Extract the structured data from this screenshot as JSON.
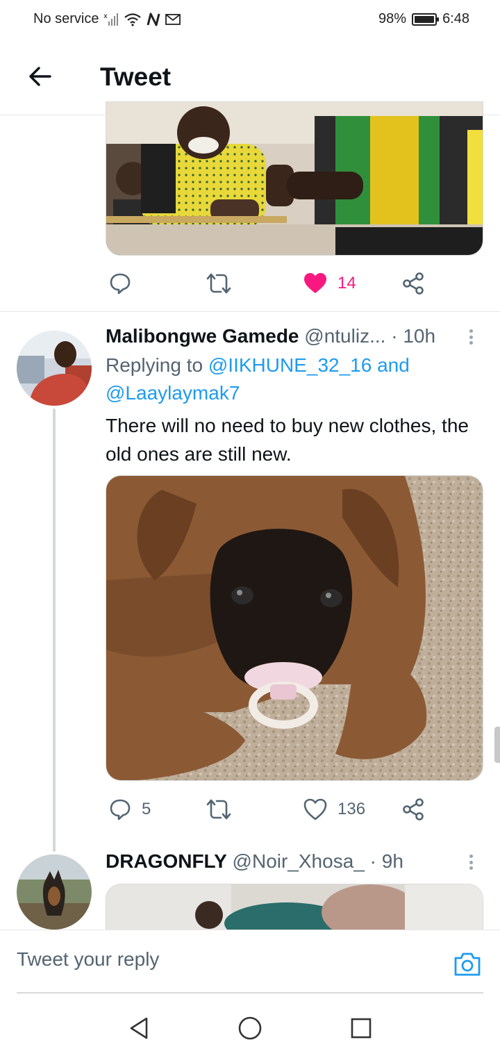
{
  "status_bar": {
    "carrier": "No service",
    "battery": "98%",
    "battery_level": 0.98,
    "time": "6:48",
    "icons": [
      "no-signal-icon",
      "wifi-icon",
      "nfc-icon",
      "gmail-icon",
      "battery-icon"
    ]
  },
  "header": {
    "title": "Tweet",
    "back_icon": "arrow-left-icon"
  },
  "tweet_above": {
    "image_alt": "photo",
    "actions": {
      "reply_count": "",
      "retweet_count": "",
      "like_count": "14",
      "liked": true
    }
  },
  "reply_tweet": {
    "name": "Malibongwe Gamede",
    "handle": "@ntuliz...",
    "separator": "·",
    "time": "10h",
    "replying_prefix": "Replying to",
    "mention_1": "@IIKHUNE_32_16",
    "conjunction": "and",
    "mention_2": "@Laaylaymak7",
    "text": "There will no need to buy new clothes, the old ones are still new.",
    "actions": {
      "reply_count": "5",
      "retweet_count": "",
      "like_count": "136",
      "liked": false
    }
  },
  "next_tweet": {
    "name": "DRAGONFLY",
    "handle": "@Noir_Xhosa_",
    "separator": "·",
    "time": "9h"
  },
  "reply_bar": {
    "placeholder": "Tweet your reply",
    "camera_icon": "camera-icon"
  },
  "colors": {
    "accent": "#1d9bf0",
    "like": "#f91880",
    "text": "#0f1419",
    "muted": "#536471"
  }
}
